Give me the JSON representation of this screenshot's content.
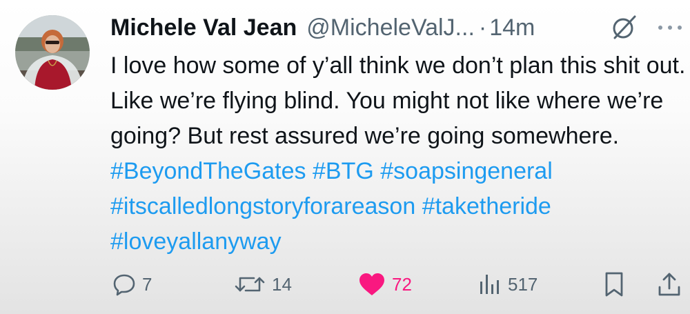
{
  "author": {
    "display_name": "Michele Val Jean",
    "handle": "@MicheleValJ...",
    "separator": "·",
    "time": "14m"
  },
  "tweet": {
    "text_before": "I love how some of y’all think we don’t plan this shit out. Like we’re flying blind. You might not like where we’re going? But rest assured we’re going somewhere. ",
    "hashtags": [
      "#BeyondTheGates",
      "#BTG",
      "#soapsingeneral",
      "#itscalledlongstoryforareason",
      "#taketheride",
      "#loveyallanyway"
    ]
  },
  "actions": {
    "replies": "7",
    "reposts": "14",
    "likes": "72",
    "views": "517"
  },
  "colors": {
    "link": "#1d9bf0",
    "like": "#f91880",
    "secondary_text": "#536471",
    "primary_text": "#0f1419"
  },
  "icons": {
    "reply": "reply-icon",
    "repost": "repost-icon",
    "like": "heart-icon",
    "views": "views-icon",
    "bookmark": "bookmark-icon",
    "share": "share-icon",
    "grok": "grok-icon",
    "more": "more-icon"
  }
}
